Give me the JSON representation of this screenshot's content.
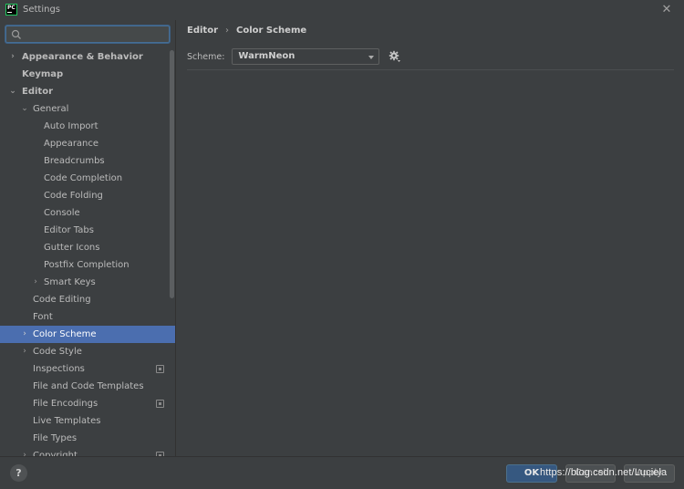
{
  "window": {
    "title": "Settings",
    "app_icon_text": "PC",
    "close_symbol": "✕"
  },
  "sidebar": {
    "search": {
      "value": "",
      "placeholder": ""
    },
    "items": [
      {
        "label": "Appearance & Behavior",
        "level": 0,
        "arrow": "›",
        "bold": true
      },
      {
        "label": "Keymap",
        "level": 0,
        "arrow": "",
        "bold": true
      },
      {
        "label": "Editor",
        "level": 0,
        "arrow": "⌄",
        "bold": true
      },
      {
        "label": "General",
        "level": 1,
        "arrow": "⌄"
      },
      {
        "label": "Auto Import",
        "level": 2,
        "arrow": ""
      },
      {
        "label": "Appearance",
        "level": 2,
        "arrow": ""
      },
      {
        "label": "Breadcrumbs",
        "level": 2,
        "arrow": ""
      },
      {
        "label": "Code Completion",
        "level": 2,
        "arrow": ""
      },
      {
        "label": "Code Folding",
        "level": 2,
        "arrow": ""
      },
      {
        "label": "Console",
        "level": 2,
        "arrow": ""
      },
      {
        "label": "Editor Tabs",
        "level": 2,
        "arrow": ""
      },
      {
        "label": "Gutter Icons",
        "level": 2,
        "arrow": ""
      },
      {
        "label": "Postfix Completion",
        "level": 2,
        "arrow": ""
      },
      {
        "label": "Smart Keys",
        "level": 2,
        "arrow": "›"
      },
      {
        "label": "Code Editing",
        "level": 1,
        "arrow": ""
      },
      {
        "label": "Font",
        "level": 1,
        "arrow": ""
      },
      {
        "label": "Color Scheme",
        "level": 1,
        "arrow": "›",
        "selected": true
      },
      {
        "label": "Code Style",
        "level": 1,
        "arrow": "›"
      },
      {
        "label": "Inspections",
        "level": 1,
        "arrow": "",
        "copy_icon": true
      },
      {
        "label": "File and Code Templates",
        "level": 1,
        "arrow": ""
      },
      {
        "label": "File Encodings",
        "level": 1,
        "arrow": "",
        "copy_icon": true
      },
      {
        "label": "Live Templates",
        "level": 1,
        "arrow": ""
      },
      {
        "label": "File Types",
        "level": 1,
        "arrow": ""
      },
      {
        "label": "Copyright",
        "level": 1,
        "arrow": "›",
        "copy_icon": true
      }
    ]
  },
  "main": {
    "breadcrumb": [
      "Editor",
      "Color Scheme"
    ],
    "breadcrumb_separator": "›",
    "scheme": {
      "label": "Scheme:",
      "selected": "WarmNeon"
    }
  },
  "footer": {
    "help_label": "?",
    "ok_label": "OK",
    "cancel_label": "Cancel",
    "apply_label": "Apply"
  },
  "watermark": "https://blog.csdn.net/Luciela",
  "colors": {
    "background": "#3c3f41",
    "selection": "#4b6eaf",
    "ok_button": "#365880",
    "search_focus": "#466d94"
  }
}
